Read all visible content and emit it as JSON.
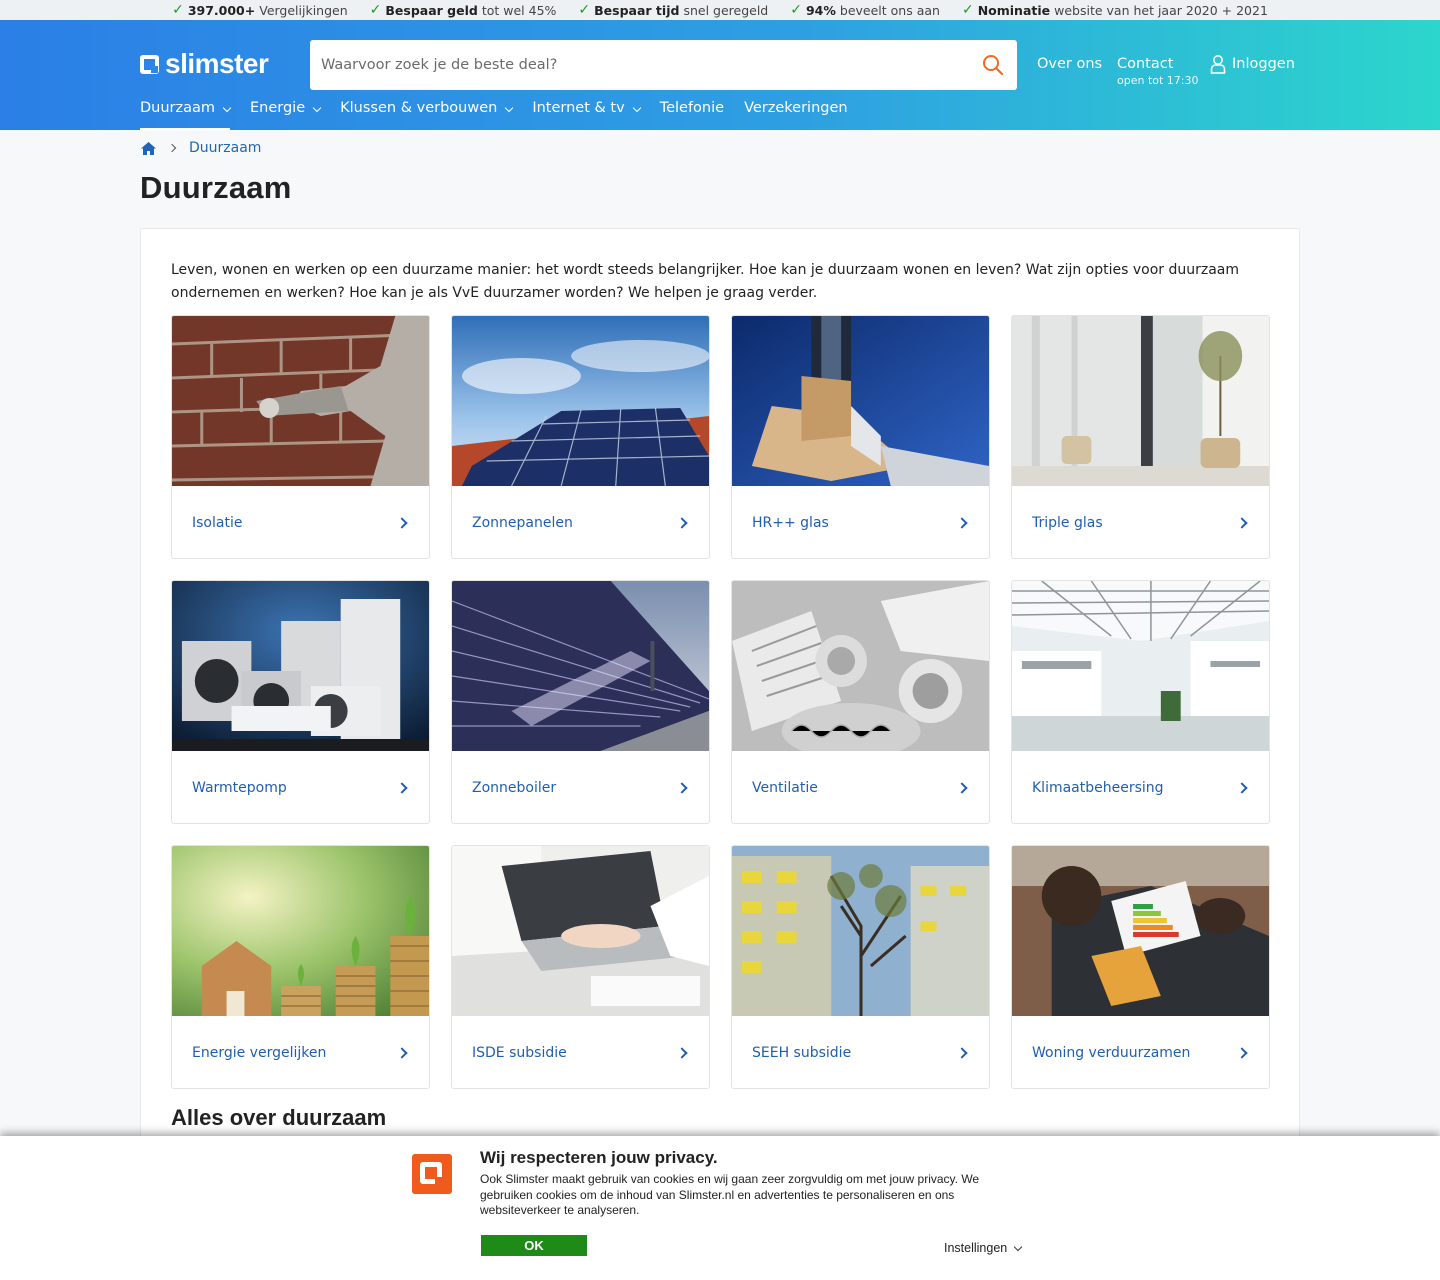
{
  "usp_bar": [
    {
      "bold": "397.000+",
      "text": "Vergelijkingen"
    },
    {
      "bold": "Bespaar geld",
      "text": "tot wel 45%"
    },
    {
      "bold": "Bespaar tijd",
      "text": "snel geregeld"
    },
    {
      "bold": "94%",
      "text": "beveelt ons aan"
    },
    {
      "bold": "Nominatie",
      "text": "website van het jaar 2020 + 2021"
    }
  ],
  "header": {
    "logo": "slimster",
    "search_placeholder": "Waarvoor zoek je de beste deal?",
    "about": "Over ons",
    "contact": "Contact",
    "contact_hours": "open tot 17:30",
    "login": "Inloggen"
  },
  "nav": [
    {
      "label": "Duurzaam",
      "dropdown": true,
      "active": true
    },
    {
      "label": "Energie",
      "dropdown": true
    },
    {
      "label": "Klussen & verbouwen",
      "dropdown": true
    },
    {
      "label": "Internet & tv",
      "dropdown": true
    },
    {
      "label": "Telefonie",
      "dropdown": false
    },
    {
      "label": "Verzekeringen",
      "dropdown": false
    }
  ],
  "breadcrumb": {
    "current": "Duurzaam"
  },
  "page": {
    "title": "Duurzaam",
    "intro": "Leven, wonen en werken op een duurzame manier: het wordt steeds belangrijker. Hoe kan je duurzaam wonen en leven? Wat zijn opties voor duurzaam ondernemen en werken? Hoe kan je als VvE duurzamer worden? We helpen je graag verder.",
    "section_title": "Alles over duurzaam"
  },
  "tiles": [
    {
      "label": "Isolatie",
      "image": "insulation-foam-brick-wall"
    },
    {
      "label": "Zonnepanelen",
      "image": "solar-panels-on-roof"
    },
    {
      "label": "HR++ glas",
      "image": "window-frame-cross-section"
    },
    {
      "label": "Triple glas",
      "image": "bright-room-glass-doors"
    },
    {
      "label": "Warmtepomp",
      "image": "heat-pump-units"
    },
    {
      "label": "Zonneboiler",
      "image": "solar-collector-tubes"
    },
    {
      "label": "Ventilatie",
      "image": "ventilation-ducts"
    },
    {
      "label": "Klimaatbeheersing",
      "image": "glass-atrium-building"
    },
    {
      "label": "Energie vergelijken",
      "image": "coins-plants-wooden-house"
    },
    {
      "label": "ISDE subsidie",
      "image": "hands-on-laptop"
    },
    {
      "label": "SEEH subsidie",
      "image": "apartment-block-trees"
    },
    {
      "label": "Woning verduurzamen",
      "image": "tablet-energy-label"
    }
  ],
  "cookie": {
    "title": "Wij respecteren jouw privacy.",
    "text": "Ook Slimster maakt gebruik van cookies en wij gaan zeer zorgvuldig om met jouw privacy. We gebruiken cookies om de inhoud van Slimster.nl en advertenties te personaliseren en ons websiteverkeer te analyseren.",
    "ok": "OK",
    "settings": "Instellingen"
  },
  "colors": {
    "header_start": "#2b7fe6",
    "header_end": "#2cd6cc",
    "link": "#1f5fb0",
    "check": "#1a9a2a",
    "ok_button": "#1e8a17",
    "brand_orange": "#f05a1c"
  }
}
